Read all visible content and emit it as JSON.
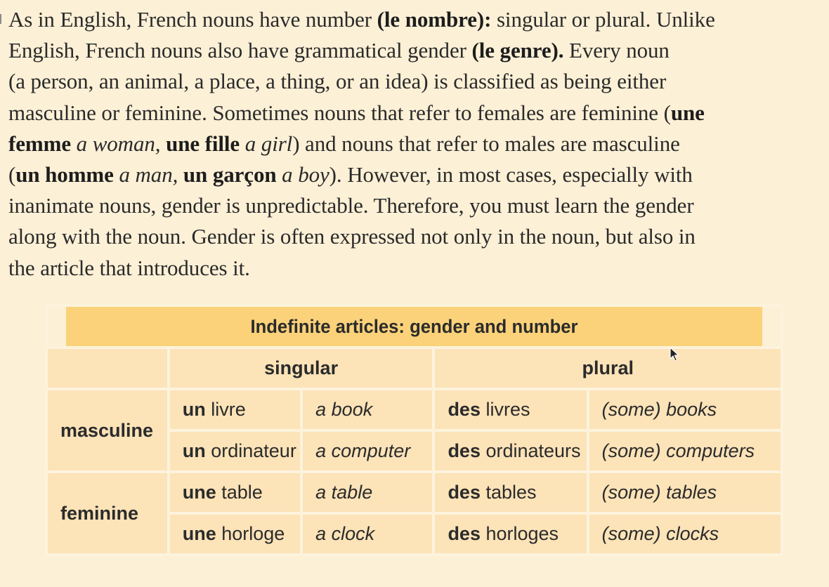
{
  "paragraph": [
    [
      {
        "t": "As in English, French nouns have number "
      },
      {
        "t": "(le nombre):",
        "b": 1
      },
      {
        "t": " singular or plural. Unlike"
      }
    ],
    [
      {
        "t": "English, French nouns also have grammatical gender "
      },
      {
        "t": "(le genre).",
        "b": 1
      },
      {
        "t": " Every noun"
      }
    ],
    [
      {
        "t": "(a person, an animal, a place, a thing, or an idea) is classified as being either"
      }
    ],
    [
      {
        "t": "masculine or feminine. Sometimes nouns that refer to females are feminine ("
      },
      {
        "t": "une",
        "b": 1
      }
    ],
    [
      {
        "t": "femme",
        "b": 1
      },
      {
        "t": " a woman,",
        "i": 1
      },
      {
        "t": " "
      },
      {
        "t": "une fille",
        "b": 1
      },
      {
        "t": " a girl",
        "i": 1
      },
      {
        "t": ") and nouns that refer to males are masculine"
      }
    ],
    [
      {
        "t": "("
      },
      {
        "t": "un homme",
        "b": 1
      },
      {
        "t": " a man,",
        "i": 1
      },
      {
        "t": " "
      },
      {
        "t": "un garçon",
        "b": 1
      },
      {
        "t": " a boy",
        "i": 1
      },
      {
        "t": "). However, in most cases, especially with"
      }
    ],
    [
      {
        "t": "inanimate nouns, gender is unpredictable. Therefore, you must learn the gender"
      }
    ],
    [
      {
        "t": "along with the noun. Gender is often expressed not only in the noun, but also in"
      }
    ],
    [
      {
        "t": "the article that introduces it."
      }
    ]
  ],
  "table": {
    "title": "Indefinite articles: gender and number",
    "headers": {
      "singular": "singular",
      "plural": "plural"
    },
    "groups": [
      {
        "gender": "masculine",
        "rows": [
          {
            "sing_article": "un",
            "sing_noun": " livre",
            "sing_en": "a book",
            "pl_article": "des",
            "pl_noun": " livres",
            "pl_en": "(some) books"
          },
          {
            "sing_article": "un",
            "sing_noun": " ordinateur",
            "sing_en": "a computer",
            "pl_article": "des",
            "pl_noun": " ordinateurs",
            "pl_en": "(some) computers"
          }
        ]
      },
      {
        "gender": "feminine",
        "rows": [
          {
            "sing_article": "une",
            "sing_noun": " table",
            "sing_en": "a table",
            "pl_article": "des",
            "pl_noun": " tables",
            "pl_en": "(some) tables"
          },
          {
            "sing_article": "une",
            "sing_noun": " horloge",
            "sing_en": "a clock",
            "pl_article": "des",
            "pl_noun": " horloges",
            "pl_en": "(some) clocks"
          }
        ]
      }
    ]
  },
  "colors": {
    "page_bg": "#fcf0d6",
    "title_band": "#fbd27a",
    "cell_bg": "#fce3b8"
  },
  "icons": {
    "cursor": "mouse-pointer-icon"
  }
}
